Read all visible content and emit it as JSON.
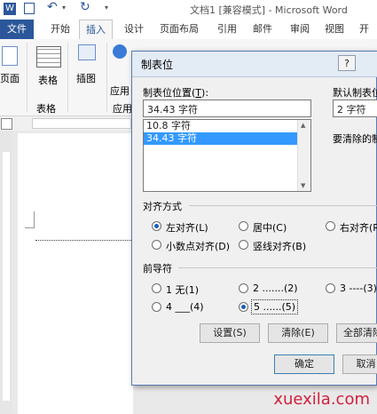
{
  "app": {
    "title": "文档1 [兼容模式] - Microsoft Word",
    "tabs": [
      "文件",
      "开始",
      "插入",
      "设计",
      "页面布局",
      "引用",
      "邮件",
      "审阅",
      "视图",
      "开发"
    ],
    "ribbon": {
      "page_btn": "页面",
      "table_btn": "表格",
      "table_group": "表格",
      "illustrations_btn": "插图",
      "apps_btn": "应用",
      "apps_group": "应用"
    }
  },
  "dialog": {
    "title": "制表位",
    "help": "?",
    "close": "✕",
    "tab_position_label": "制表位位置(",
    "tab_position_key": "T",
    "tab_position_value": "34.43 字符",
    "tab_list": [
      "10.8 字符",
      "34.43 字符"
    ],
    "default_tab_label": "默认制表位",
    "default_tab_value": "2 字符",
    "clear_label": "要清除的制",
    "align_label": "对齐方式",
    "align_options": [
      {
        "text": "左对齐(L)",
        "checked": true
      },
      {
        "text": "居中(C)",
        "checked": false
      },
      {
        "text": "右对齐(R",
        "checked": false
      },
      {
        "text": "小数点对齐(D)",
        "checked": false
      },
      {
        "text": "竖线对齐(B)",
        "checked": false
      }
    ],
    "leader_label": "前导符",
    "leader_options": [
      {
        "text": "1 无(1)",
        "checked": false
      },
      {
        "text": "2 .......(2)",
        "checked": false
      },
      {
        "text": "3 ----(3)",
        "checked": false
      },
      {
        "text": "4 ___(4)",
        "checked": false
      },
      {
        "text": "5 ......(5)",
        "checked": true
      }
    ],
    "set_button": "设置(S)",
    "clear_button": "清除(E)",
    "clear_all_button": "全部清除",
    "ok_button": "确定",
    "cancel_button": "取消"
  },
  "watermark": "xuexila.com"
}
